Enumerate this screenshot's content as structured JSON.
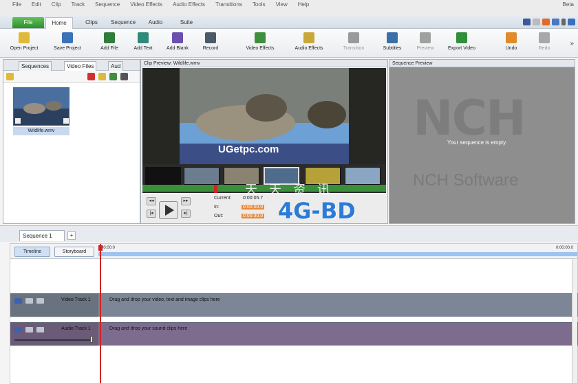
{
  "menu": [
    "File",
    "Edit",
    "Clip",
    "Track",
    "Sequence",
    "Video Effects",
    "Audio Effects",
    "Transitions",
    "Tools",
    "View",
    "Help"
  ],
  "menu_right": "Beta",
  "ribbon": {
    "file_tab": "File",
    "tabs": [
      "Home",
      "Clips",
      "Sequence",
      "Audio",
      "Suite"
    ],
    "active_tab": "Home"
  },
  "toolbar": [
    {
      "label": "Open Project",
      "icon": "folder-icon",
      "color": "#e0b93a",
      "enabled": true
    },
    {
      "label": "Save Project",
      "icon": "save-icon",
      "color": "#3b73b9",
      "enabled": true
    },
    {
      "label": "Add File",
      "icon": "add-file-icon",
      "color": "#2f7d3a",
      "enabled": true
    },
    {
      "label": "Add Text",
      "icon": "add-text-icon",
      "color": "#2f8a7a",
      "enabled": true
    },
    {
      "label": "Add Blank",
      "icon": "add-blank-icon",
      "color": "#6a4fb0",
      "enabled": true
    },
    {
      "label": "Record",
      "icon": "record-icon",
      "color": "#4b5a6a",
      "enabled": true
    },
    {
      "label": "Video Effects",
      "icon": "video-effects-icon",
      "color": "#3f8f3f",
      "enabled": true
    },
    {
      "label": "Audio Effects",
      "icon": "audio-effects-icon",
      "color": "#c9a83a",
      "enabled": true
    },
    {
      "label": "Transition",
      "icon": "transition-icon",
      "color": "#9a9a9a",
      "enabled": false
    },
    {
      "label": "Subtitles",
      "icon": "subtitles-icon",
      "color": "#3b6fa8",
      "enabled": true
    },
    {
      "label": "Preview",
      "icon": "preview-icon",
      "color": "#a0a0a0",
      "enabled": false
    },
    {
      "label": "Export Video",
      "icon": "export-video-icon",
      "color": "#2f8f3a",
      "enabled": true
    },
    {
      "label": "Undo",
      "icon": "undo-icon",
      "color": "#e08a2a",
      "enabled": true
    },
    {
      "label": "Redo",
      "icon": "redo-icon",
      "color": "#a8a8a8",
      "enabled": false
    }
  ],
  "left_panel": {
    "tabs": [
      "Sequences",
      "Video Files",
      "Aud"
    ],
    "active_tab": "Video Files",
    "file_name": "Wildlife.wmv"
  },
  "clip_preview": {
    "title": "Clip Preview: Wildlife.wmv",
    "overlay_site": "UGetpc.com",
    "current_label": "Current:",
    "current_value": "0:00:05.7",
    "in_label": "In:",
    "in_value": "0:00:00.0",
    "out_label": "Out:",
    "out_value": "0:00:30.0"
  },
  "sequence_preview": {
    "title": "Sequence Preview",
    "empty_message": "Your sequence is empty.",
    "logo": "NCH",
    "brand": "NCH Software"
  },
  "watermark": {
    "main": "4G-BD",
    "top": "天 天 资 讯"
  },
  "sequence_tab": {
    "label": "Sequence 1",
    "add": "+"
  },
  "timeline": {
    "buttons": [
      "Timeline",
      "Storyboard"
    ],
    "start_time": "00:00:0",
    "end_time": "0:00:00.0",
    "tracks": [
      {
        "name": "Video Track 1",
        "hint": "Drag and drop your video, text and image clips here",
        "type": "video"
      },
      {
        "name": "Audio Track 1",
        "hint": "Drag and drop your sound clips here",
        "type": "audio"
      }
    ]
  },
  "colors": {
    "accent": "#2f8f2b",
    "playhead": "#d02525",
    "ruler": "#9ec3f3",
    "video_track": "#7c8696",
    "audio_track": "#7e6c8e"
  }
}
